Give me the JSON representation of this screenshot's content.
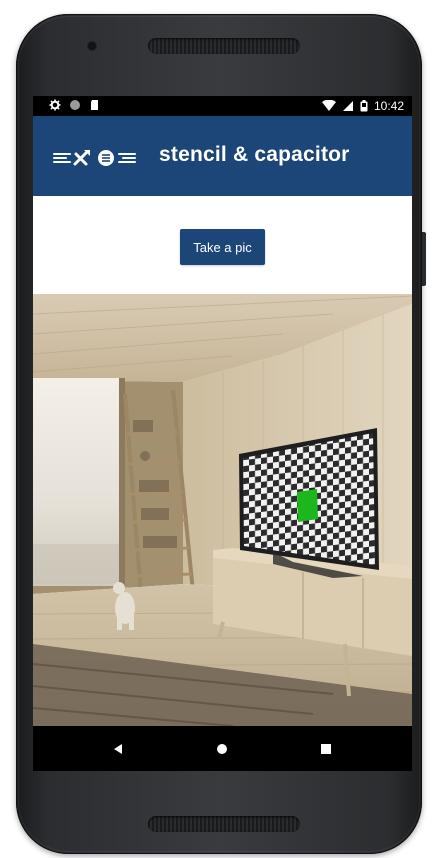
{
  "status_bar": {
    "time": "10:42",
    "left_icons": [
      "settings-icon",
      "circle-icon",
      "sd-card-icon"
    ],
    "right_icons": [
      "wifi-icon",
      "signal-icon",
      "battery-icon"
    ]
  },
  "app_bar": {
    "title": "stencil & capacitor",
    "background_color": "#1c4678"
  },
  "main": {
    "take_pic_label": "Take a pic",
    "button_color": "#1c4678"
  },
  "image": {
    "description_icon": "room-with-tv-photo",
    "tv_screen_pattern": "checkerboard",
    "marker_color": "#1db71d"
  },
  "nav_bar": {
    "buttons": [
      "back-icon",
      "home-icon",
      "recents-icon"
    ]
  }
}
